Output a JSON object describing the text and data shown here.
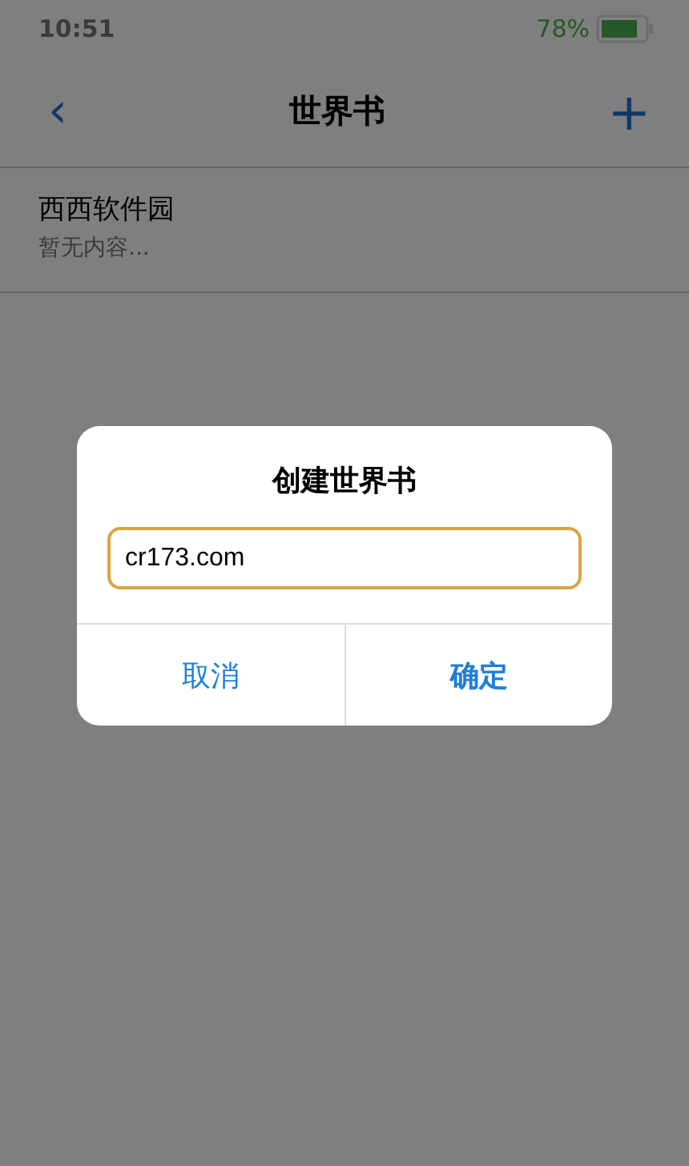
{
  "status_bar": {
    "time": "10:51",
    "battery_text": "78%"
  },
  "nav": {
    "back": "‹",
    "title": "世界书",
    "add": "+"
  },
  "list": [
    {
      "title": "西西软件园",
      "subtitle": "暂无内容..."
    }
  ],
  "dialog": {
    "title": "创建世界书",
    "input": {
      "value": "cr173.com",
      "focused": true
    },
    "buttons": [
      {
        "label": "取消",
        "kind": "cancel"
      },
      {
        "label": "确定",
        "kind": "confirm"
      }
    ]
  }
}
